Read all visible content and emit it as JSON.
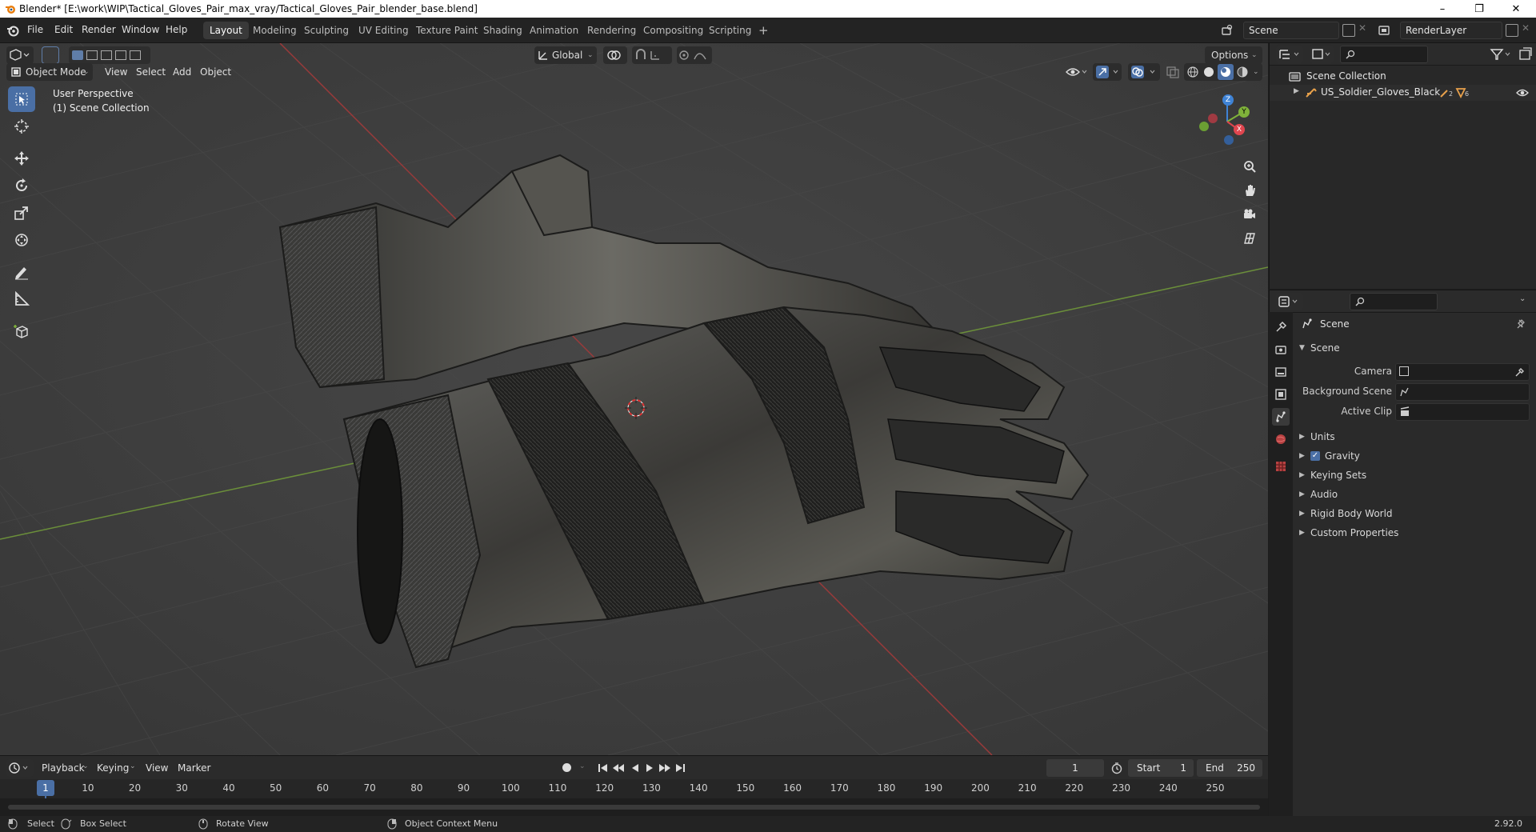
{
  "window": {
    "title": "Blender* [E:\\work\\WIP\\Tactical_Gloves_Pair_max_vray/Tactical_Gloves_Pair_blender_base.blend]",
    "minimize": "–",
    "restore": "❐",
    "close": "✕"
  },
  "menu": {
    "items": [
      "File",
      "Edit",
      "Render",
      "Window",
      "Help"
    ]
  },
  "workspaces": [
    "Layout",
    "Modeling",
    "Sculpting",
    "UV Editing",
    "Texture Paint",
    "Shading",
    "Animation",
    "Rendering",
    "Compositing",
    "Scripting"
  ],
  "active_workspace": "Layout",
  "add_workspace": "+",
  "scene_field": "Scene",
  "renderlayer_field": "RenderLayer",
  "viewport_header": {
    "mode": "Object Mode",
    "menus": [
      "View",
      "Select",
      "Add",
      "Object"
    ],
    "transform_orientation": "Global",
    "options": "Options"
  },
  "viewport": {
    "perspective": "User Perspective",
    "collection": "(1) Scene Collection",
    "gizmo": {
      "x": "X",
      "y": "Y",
      "z": "Z"
    }
  },
  "outliner": {
    "root": "Scene Collection",
    "items": [
      {
        "label": "US_Soldier_Gloves_Black",
        "badge1": "2",
        "badge2": "6"
      }
    ]
  },
  "properties": {
    "context": "Scene",
    "panel": "Scene",
    "fields": [
      {
        "label": "Camera",
        "value": ""
      },
      {
        "label": "Background Scene",
        "value": ""
      },
      {
        "label": "Active Clip",
        "value": ""
      }
    ],
    "subpanels": [
      "Units",
      "Gravity",
      "Keying Sets",
      "Audio",
      "Rigid Body World",
      "Custom Properties"
    ],
    "gravity_checked": true
  },
  "timeline": {
    "menus": [
      "Playback",
      "Keying",
      "View",
      "Marker"
    ],
    "current_frame": "1",
    "start_label": "Start",
    "start": "1",
    "end_label": "End",
    "end": "250",
    "ruler": [
      "1",
      "10",
      "20",
      "30",
      "40",
      "50",
      "60",
      "70",
      "80",
      "90",
      "100",
      "110",
      "120",
      "130",
      "140",
      "150",
      "160",
      "170",
      "180",
      "190",
      "200",
      "210",
      "220",
      "230",
      "240",
      "250"
    ]
  },
  "statusbar": {
    "select": "Select",
    "box_select": "Box Select",
    "rotate": "Rotate View",
    "context_menu": "Object Context Menu",
    "version": "2.92.0"
  },
  "colors": {
    "accent": "#4a6fa5",
    "x_axis": "#e0464f",
    "y_axis": "#7fb23a",
    "z_axis": "#3f83d6",
    "viewport_bg": "#3d3d3d"
  }
}
